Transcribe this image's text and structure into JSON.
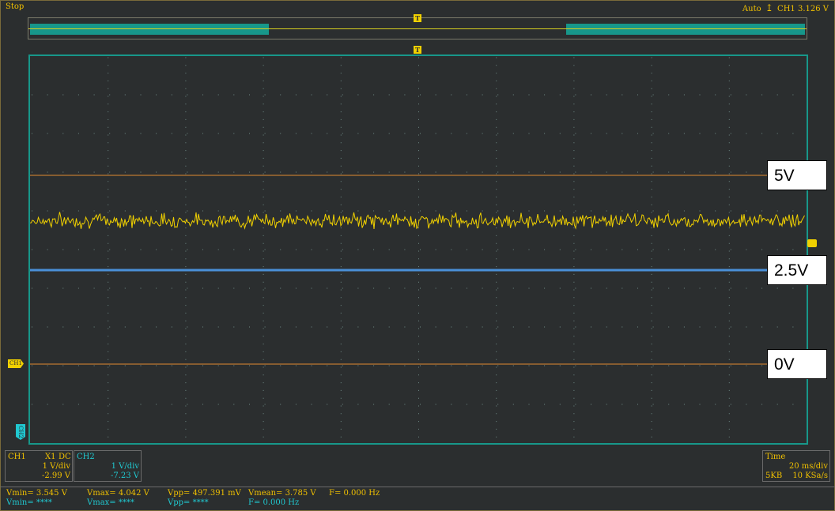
{
  "status": {
    "run_state": "Stop",
    "trigger_mode": "Auto",
    "trigger_source": "CH1",
    "trigger_level": "3.126 V"
  },
  "markers": {
    "trigger": "T",
    "ch1": "CH1",
    "ch2": "CH2"
  },
  "ref_labels": {
    "top": "5V",
    "middle": "2.5V",
    "bottom": "0V"
  },
  "ch1_panel": {
    "name": "CH1",
    "probe": "X1",
    "coupling": "DC",
    "scale": "1 V/div",
    "offset": "-2.99 V"
  },
  "ch2_panel": {
    "name": "CH2",
    "scale": "1 V/div",
    "offset": "-7.23 V"
  },
  "time_panel": {
    "title": "Time",
    "timebase": "20 ms/div",
    "memory": "5KB",
    "sample_rate": "10 KSa/s"
  },
  "measurements": {
    "ch1": {
      "vmin": "Vmin= 3.545 V",
      "vmax": "Vmax= 4.042 V",
      "vpp": "Vpp= 497.391 mV",
      "vmean": "Vmean= 3.785 V",
      "freq": "F= 0.000 Hz"
    },
    "ch2": {
      "vmin": "Vmin= ****",
      "vmax": "Vmax= ****",
      "vpp": "Vpp= ****",
      "freq": "F= 0.000 Hz"
    }
  },
  "colors": {
    "ch1": "#f0d000",
    "ch2": "#20c8d0",
    "grid_border": "#17978a",
    "ref_line": "#e08a30",
    "mid_line": "#4a90d8"
  },
  "icons": {
    "trigger_edge": "rising-edge-icon"
  },
  "trace": {
    "ch1_mean_v": 3.785,
    "ch1_min_v": 3.545,
    "ch1_max_v": 4.042
  }
}
